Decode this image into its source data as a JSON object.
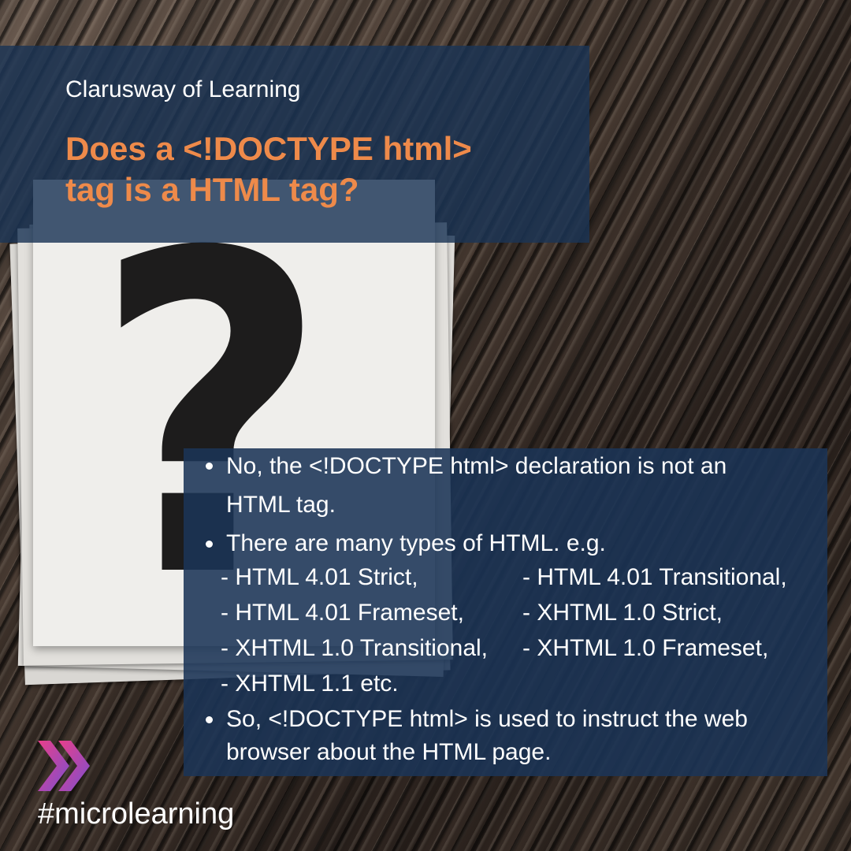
{
  "brand": "Clarusway of Learning",
  "headline": {
    "line1": "Does a <!DOCTYPE html>",
    "line2": "tag is a HTML tag?"
  },
  "background_icon": "question-mark-icon",
  "colors": {
    "panel": "#1b3456",
    "headline": "#ee8a4a",
    "text": "#ffffff",
    "logo_gradient": [
      "#e93f8a",
      "#7b4fd0"
    ]
  },
  "bullets": {
    "b1_line1": "No, the <!DOCTYPE html> declaration is not an",
    "b1_line2": "HTML tag.",
    "b2_line1": "There are many types of HTML. e.g.",
    "types_row1_a": "- HTML 4.01 Strict,",
    "types_row1_b": "- HTML 4.01 Transitional,",
    "types_row2_a": "- HTML 4.01 Frameset,",
    "types_row2_b": "- XHTML 1.0 Strict,",
    "types_row3_a": "- XHTML 1.0 Transitional,",
    "types_row3_b": "- XHTML 1.0 Frameset,",
    "types_row4_a": "- XHTML 1.1 etc.",
    "b3_line1": " So, <!DOCTYPE html> is used to instruct the web",
    "b3_line2": "browser about the HTML page."
  },
  "logo_icon": "double-chevron-right-icon",
  "hashtag": "#microlearning"
}
